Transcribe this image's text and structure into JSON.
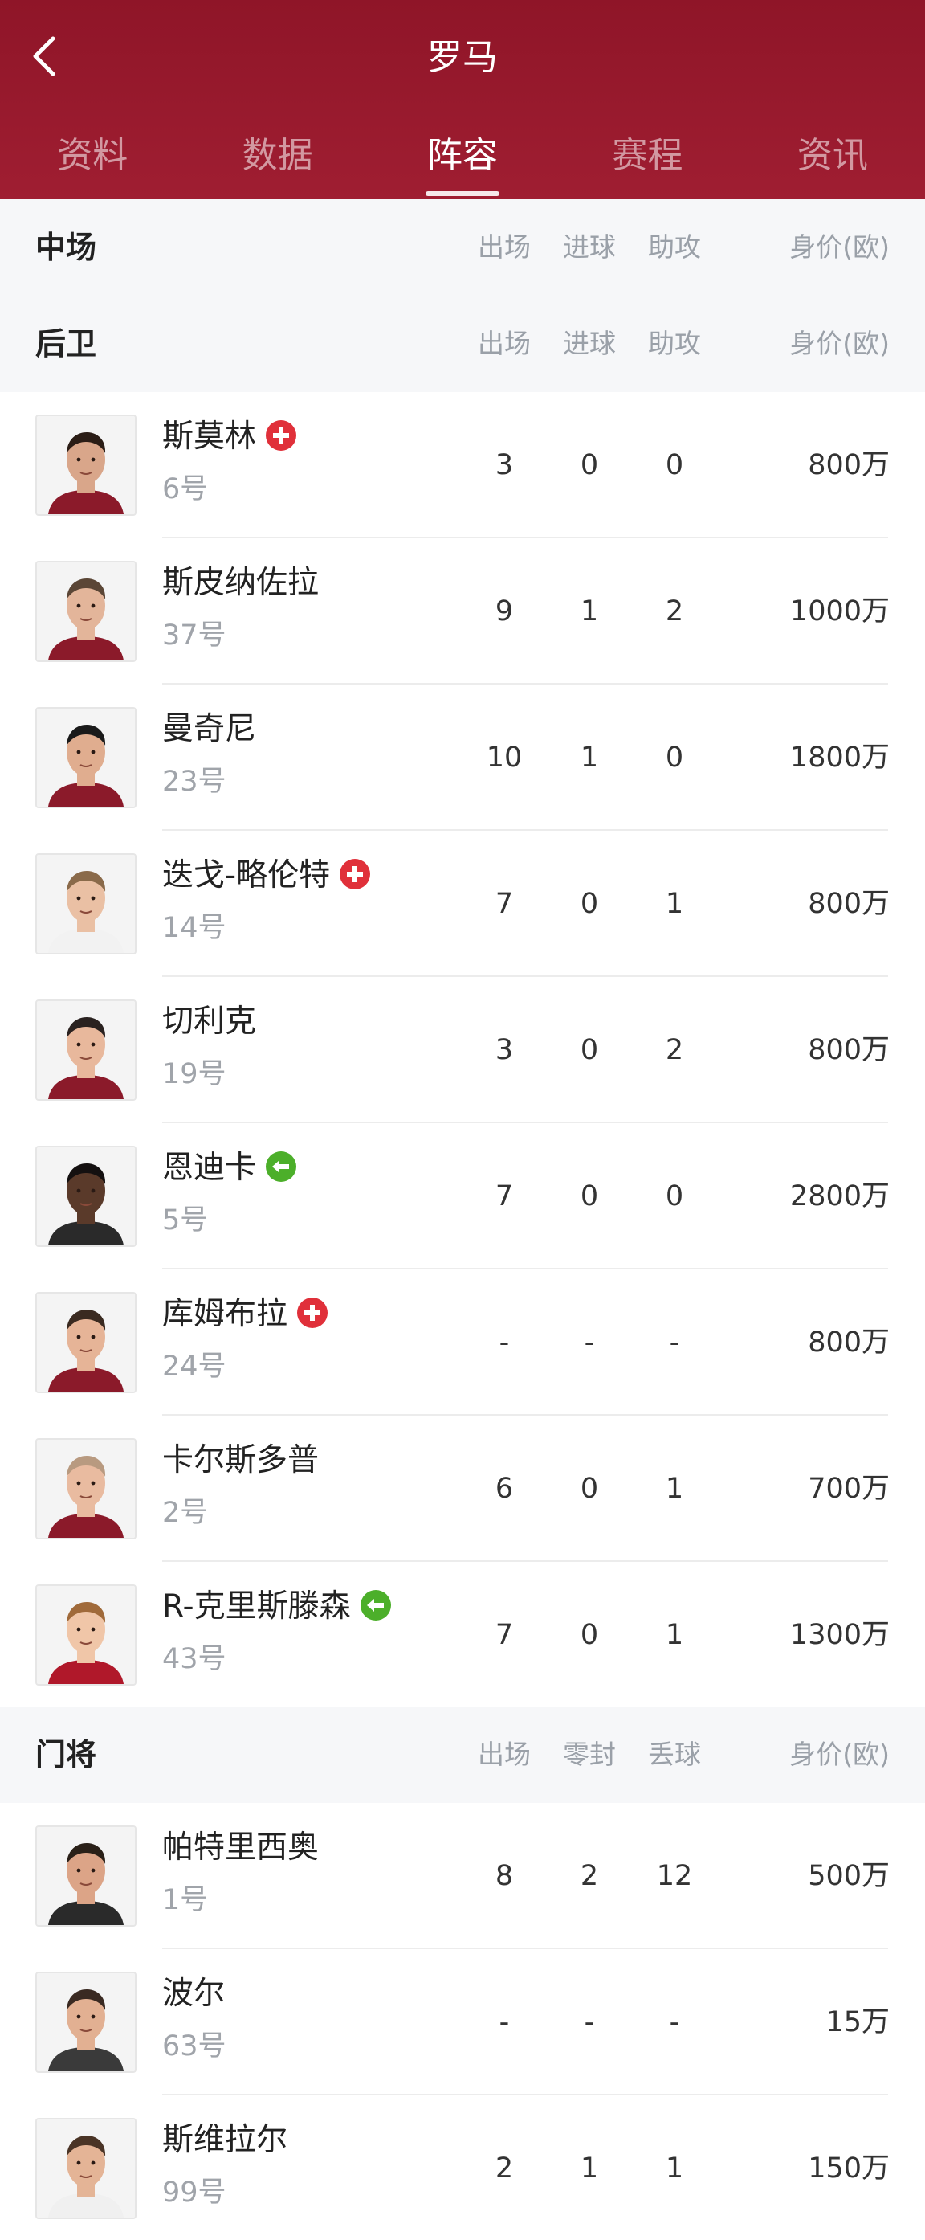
{
  "header": {
    "title": "罗马",
    "tabs": [
      {
        "label": "资料"
      },
      {
        "label": "数据"
      },
      {
        "label": "阵容"
      },
      {
        "label": "赛程"
      },
      {
        "label": "资讯"
      }
    ],
    "active_tab": "阵容"
  },
  "colors": {
    "brand": "#9c1b2e",
    "injury_badge": "#e0303a",
    "return_badge": "#4caf2a"
  },
  "sections": {
    "midfield": {
      "title": "中场",
      "cols": [
        "出场",
        "进球",
        "助攻",
        "身价(欧)"
      ]
    },
    "defenders": {
      "title": "后卫",
      "cols": [
        "出场",
        "进球",
        "助攻",
        "身价(欧)"
      ]
    },
    "goalkeepers": {
      "title": "门将",
      "cols": [
        "出场",
        "零封",
        "丢球",
        "身价(欧)"
      ]
    }
  },
  "defenders": [
    {
      "name": "斯莫林",
      "number": "6号",
      "badge": "injury",
      "s1": "3",
      "s2": "0",
      "s3": "0",
      "value": "800万"
    },
    {
      "name": "斯皮纳佐拉",
      "number": "37号",
      "badge": "",
      "s1": "9",
      "s2": "1",
      "s3": "2",
      "value": "1000万"
    },
    {
      "name": "曼奇尼",
      "number": "23号",
      "badge": "",
      "s1": "10",
      "s2": "1",
      "s3": "0",
      "value": "1800万"
    },
    {
      "name": "迭戈-略伦特",
      "number": "14号",
      "badge": "injury",
      "s1": "7",
      "s2": "0",
      "s3": "1",
      "value": "800万"
    },
    {
      "name": "切利克",
      "number": "19号",
      "badge": "",
      "s1": "3",
      "s2": "0",
      "s3": "2",
      "value": "800万"
    },
    {
      "name": "恩迪卡",
      "number": "5号",
      "badge": "return",
      "s1": "7",
      "s2": "0",
      "s3": "0",
      "value": "2800万"
    },
    {
      "name": "库姆布拉",
      "number": "24号",
      "badge": "injury",
      "s1": "-",
      "s2": "-",
      "s3": "-",
      "value": "800万"
    },
    {
      "name": "卡尔斯多普",
      "number": "2号",
      "badge": "",
      "s1": "6",
      "s2": "0",
      "s3": "1",
      "value": "700万"
    },
    {
      "name": "R-克里斯滕森",
      "number": "43号",
      "badge": "return",
      "s1": "7",
      "s2": "0",
      "s3": "1",
      "value": "1300万"
    }
  ],
  "goalkeepers": [
    {
      "name": "帕特里西奥",
      "number": "1号",
      "badge": "",
      "s1": "8",
      "s2": "2",
      "s3": "12",
      "value": "500万"
    },
    {
      "name": "波尔",
      "number": "63号",
      "badge": "",
      "s1": "-",
      "s2": "-",
      "s3": "-",
      "value": "15万"
    },
    {
      "name": "斯维拉尔",
      "number": "99号",
      "badge": "",
      "s1": "2",
      "s2": "1",
      "s3": "1",
      "value": "150万"
    }
  ]
}
